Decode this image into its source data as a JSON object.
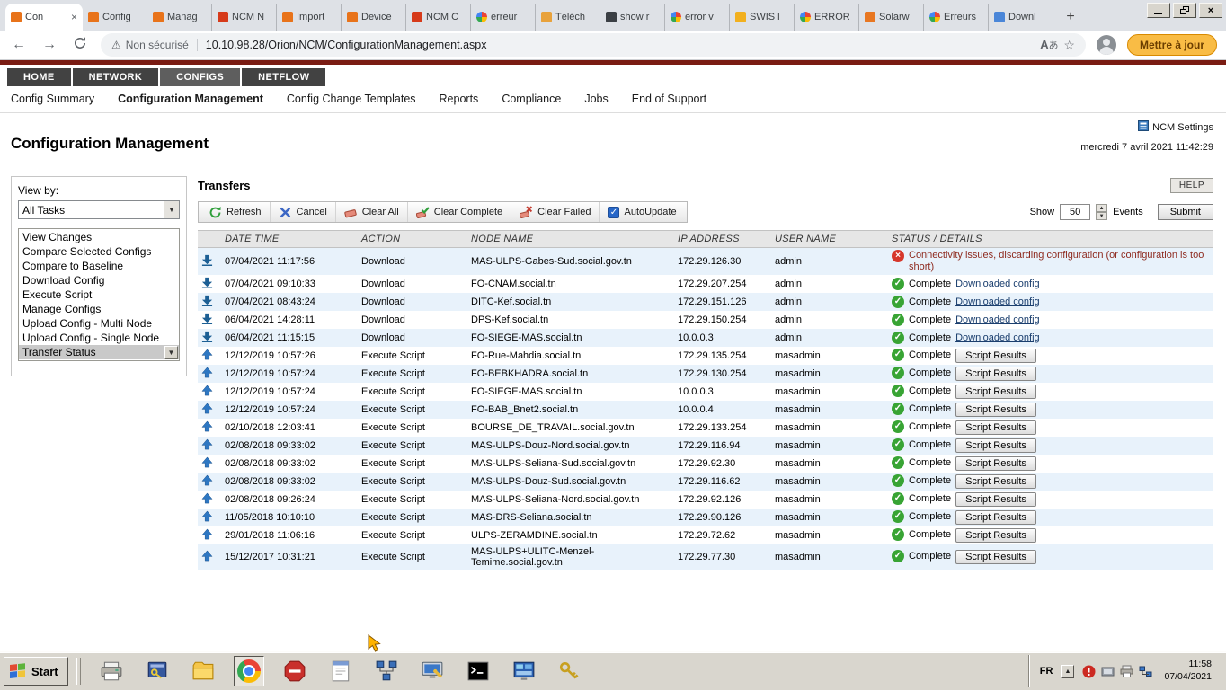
{
  "browser": {
    "new_tab": "+",
    "tabs": [
      {
        "label": "Con",
        "active": true,
        "favicon": "#e8731a"
      },
      {
        "label": "Config",
        "favicon": "#e8731a"
      },
      {
        "label": "Manag",
        "favicon": "#e8731a"
      },
      {
        "label": "NCM N",
        "favicon": "#d63a1a"
      },
      {
        "label": "Import",
        "favicon": "#e8731a"
      },
      {
        "label": "Device",
        "favicon": "#e8731a"
      },
      {
        "label": "NCM C",
        "favicon": "#d63a1a"
      },
      {
        "label": "erreur",
        "favicon": "google"
      },
      {
        "label": "Téléch",
        "favicon": "#e8a23c"
      },
      {
        "label": "show r",
        "favicon": "#3b3f44"
      },
      {
        "label": "error v",
        "favicon": "google"
      },
      {
        "label": "SWIS l",
        "favicon": "#f2b01e"
      },
      {
        "label": "ERROR",
        "favicon": "google"
      },
      {
        "label": "Solarw",
        "favicon": "#e87722"
      },
      {
        "label": "Erreurs",
        "favicon": "google"
      },
      {
        "label": "Downl",
        "favicon": "#4a86d8"
      }
    ],
    "address": {
      "security_label": "Non sécurisé",
      "url": "10.10.98.28/Orion/NCM/ConfigurationManagement.aspx",
      "update_button": "Mettre à jour"
    }
  },
  "site": {
    "nav_tabs": [
      {
        "label": "HOME",
        "active": false
      },
      {
        "label": "NETWORK",
        "active": false
      },
      {
        "label": "CONFIGS",
        "active": true
      },
      {
        "label": "NETFLOW",
        "active": false
      }
    ],
    "subnav": [
      "Config Summary",
      "Configuration Management",
      "Config Change Templates",
      "Reports",
      "Compliance",
      "Jobs",
      "End of Support"
    ],
    "active_subnav": "Configuration Management",
    "page_title": "Configuration Management",
    "ncm_settings_label": "NCM Settings",
    "timestamp": "mercredi 7 avril 2021 11:42:29"
  },
  "sidebar": {
    "view_by_label": "View by:",
    "selected_view": "All Tasks",
    "tasks": [
      "View Changes",
      "Compare Selected Configs",
      "Compare to Baseline",
      "Download Config",
      "Execute Script",
      "Manage Configs",
      "Upload Config - Multi Node",
      "Upload Config - Single Node",
      "Transfer Status"
    ],
    "selected_task": "Transfer Status"
  },
  "transfers": {
    "title": "Transfers",
    "help_button": "HELP",
    "toolbar": {
      "buttons": [
        {
          "name": "refresh",
          "label": "Refresh"
        },
        {
          "name": "cancel",
          "label": "Cancel"
        },
        {
          "name": "clear-all",
          "label": "Clear All"
        },
        {
          "name": "clear-complete",
          "label": "Clear Complete"
        },
        {
          "name": "clear-failed",
          "label": "Clear Failed"
        }
      ],
      "autoupdate_label": "AutoUpdate",
      "autoupdate_checked": true,
      "show_label": "Show",
      "show_value": "50",
      "events_label": "Events",
      "submit_label": "Submit"
    },
    "columns": [
      "DATE TIME",
      "ACTION",
      "NODE NAME",
      "IP ADDRESS",
      "USER NAME",
      "STATUS / DETAILS"
    ],
    "rows": [
      {
        "datetime": "07/04/2021 11:17:56",
        "action": "Download",
        "node": "MAS-ULPS-Gabes-Sud.social.gov.tn",
        "ip": "172.29.126.30",
        "user": "admin",
        "status": "failed",
        "detail": "Connectivity issues, discarding configuration (or configuration is too short)",
        "detail_type": "text"
      },
      {
        "datetime": "07/04/2021 09:10:33",
        "action": "Download",
        "node": "FO-CNAM.social.tn",
        "ip": "172.29.207.254",
        "user": "admin",
        "status": "complete",
        "status_label": "Complete",
        "detail": "Downloaded config",
        "detail_type": "link"
      },
      {
        "datetime": "07/04/2021 08:43:24",
        "action": "Download",
        "node": "DITC-Kef.social.tn",
        "ip": "172.29.151.126",
        "user": "admin",
        "status": "complete",
        "status_label": "Complete",
        "detail": "Downloaded config",
        "detail_type": "link"
      },
      {
        "datetime": "06/04/2021 14:28:11",
        "action": "Download",
        "node": "DPS-Kef.social.tn",
        "ip": "172.29.150.254",
        "user": "admin",
        "status": "complete",
        "status_label": "Complete",
        "detail": "Downloaded config",
        "detail_type": "link"
      },
      {
        "datetime": "06/04/2021 11:15:15",
        "action": "Download",
        "node": "FO-SIEGE-MAS.social.tn",
        "ip": "10.0.0.3",
        "user": "admin",
        "status": "complete",
        "status_label": "Complete",
        "detail": "Downloaded config",
        "detail_type": "link"
      },
      {
        "datetime": "12/12/2019 10:57:26",
        "action": "Execute Script",
        "node": "FO-Rue-Mahdia.social.tn",
        "ip": "172.29.135.254",
        "user": "masadmin",
        "status": "complete",
        "status_label": "Complete",
        "detail": "Script Results",
        "detail_type": "button"
      },
      {
        "datetime": "12/12/2019 10:57:24",
        "action": "Execute Script",
        "node": "FO-BEBKHADRA.social.tn",
        "ip": "172.29.130.254",
        "user": "masadmin",
        "status": "complete",
        "status_label": "Complete",
        "detail": "Script Results",
        "detail_type": "button"
      },
      {
        "datetime": "12/12/2019 10:57:24",
        "action": "Execute Script",
        "node": "FO-SIEGE-MAS.social.tn",
        "ip": "10.0.0.3",
        "user": "masadmin",
        "status": "complete",
        "status_label": "Complete",
        "detail": "Script Results",
        "detail_type": "button"
      },
      {
        "datetime": "12/12/2019 10:57:24",
        "action": "Execute Script",
        "node": "FO-BAB_Bnet2.social.tn",
        "ip": "10.0.0.4",
        "user": "masadmin",
        "status": "complete",
        "status_label": "Complete",
        "detail": "Script Results",
        "detail_type": "button"
      },
      {
        "datetime": "02/10/2018 12:03:41",
        "action": "Execute Script",
        "node": "BOURSE_DE_TRAVAIL.social.gov.tn",
        "ip": "172.29.133.254",
        "user": "masadmin",
        "status": "complete",
        "status_label": "Complete",
        "detail": "Script Results",
        "detail_type": "button"
      },
      {
        "datetime": "02/08/2018 09:33:02",
        "action": "Execute Script",
        "node": "MAS-ULPS-Douz-Nord.social.gov.tn",
        "ip": "172.29.116.94",
        "user": "masadmin",
        "status": "complete",
        "status_label": "Complete",
        "detail": "Script Results",
        "detail_type": "button"
      },
      {
        "datetime": "02/08/2018 09:33:02",
        "action": "Execute Script",
        "node": "MAS-ULPS-Seliana-Sud.social.gov.tn",
        "ip": "172.29.92.30",
        "user": "masadmin",
        "status": "complete",
        "status_label": "Complete",
        "detail": "Script Results",
        "detail_type": "button"
      },
      {
        "datetime": "02/08/2018 09:33:02",
        "action": "Execute Script",
        "node": "MAS-ULPS-Douz-Sud.social.gov.tn",
        "ip": "172.29.116.62",
        "user": "masadmin",
        "status": "complete",
        "status_label": "Complete",
        "detail": "Script Results",
        "detail_type": "button"
      },
      {
        "datetime": "02/08/2018 09:26:24",
        "action": "Execute Script",
        "node": "MAS-ULPS-Seliana-Nord.social.gov.tn",
        "ip": "172.29.92.126",
        "user": "masadmin",
        "status": "complete",
        "status_label": "Complete",
        "detail": "Script Results",
        "detail_type": "button"
      },
      {
        "datetime": "11/05/2018 10:10:10",
        "action": "Execute Script",
        "node": "MAS-DRS-Seliana.social.tn",
        "ip": "172.29.90.126",
        "user": "masadmin",
        "status": "complete",
        "status_label": "Complete",
        "detail": "Script Results",
        "detail_type": "button"
      },
      {
        "datetime": "29/01/2018 11:06:16",
        "action": "Execute Script",
        "node": "ULPS-ZERAMDINE.social.tn",
        "ip": "172.29.72.62",
        "user": "masadmin",
        "status": "complete",
        "status_label": "Complete",
        "detail": "Script Results",
        "detail_type": "button"
      },
      {
        "datetime": "15/12/2017 10:31:21",
        "action": "Execute Script",
        "node": "MAS-ULPS+ULITC-Menzel-Temime.social.gov.tn",
        "ip": "172.29.77.30",
        "user": "masadmin",
        "status": "complete",
        "status_label": "Complete",
        "detail": "Script Results",
        "detail_type": "button"
      }
    ]
  },
  "taskbar": {
    "start_label": "Start",
    "quick_launch": [
      "printer-icon",
      "security-console-icon",
      "folder-icon",
      "chrome-icon",
      "stop-icon",
      "notepad-icon",
      "network-map-icon",
      "device-manager-icon",
      "cmd-icon",
      "system-monitor-icon",
      "keys-icon"
    ],
    "tray": {
      "language": "FR",
      "icons": [
        "alert-icon",
        "device-icon",
        "printer-tray-icon",
        "network-tray-icon"
      ],
      "time": "11:58",
      "date": "07/04/2021"
    }
  },
  "colors": {
    "status_ok": "#38a434",
    "status_error": "#d6372b",
    "brand_maroon": "#7a1c13",
    "row_alt": "#e8f2fb"
  }
}
